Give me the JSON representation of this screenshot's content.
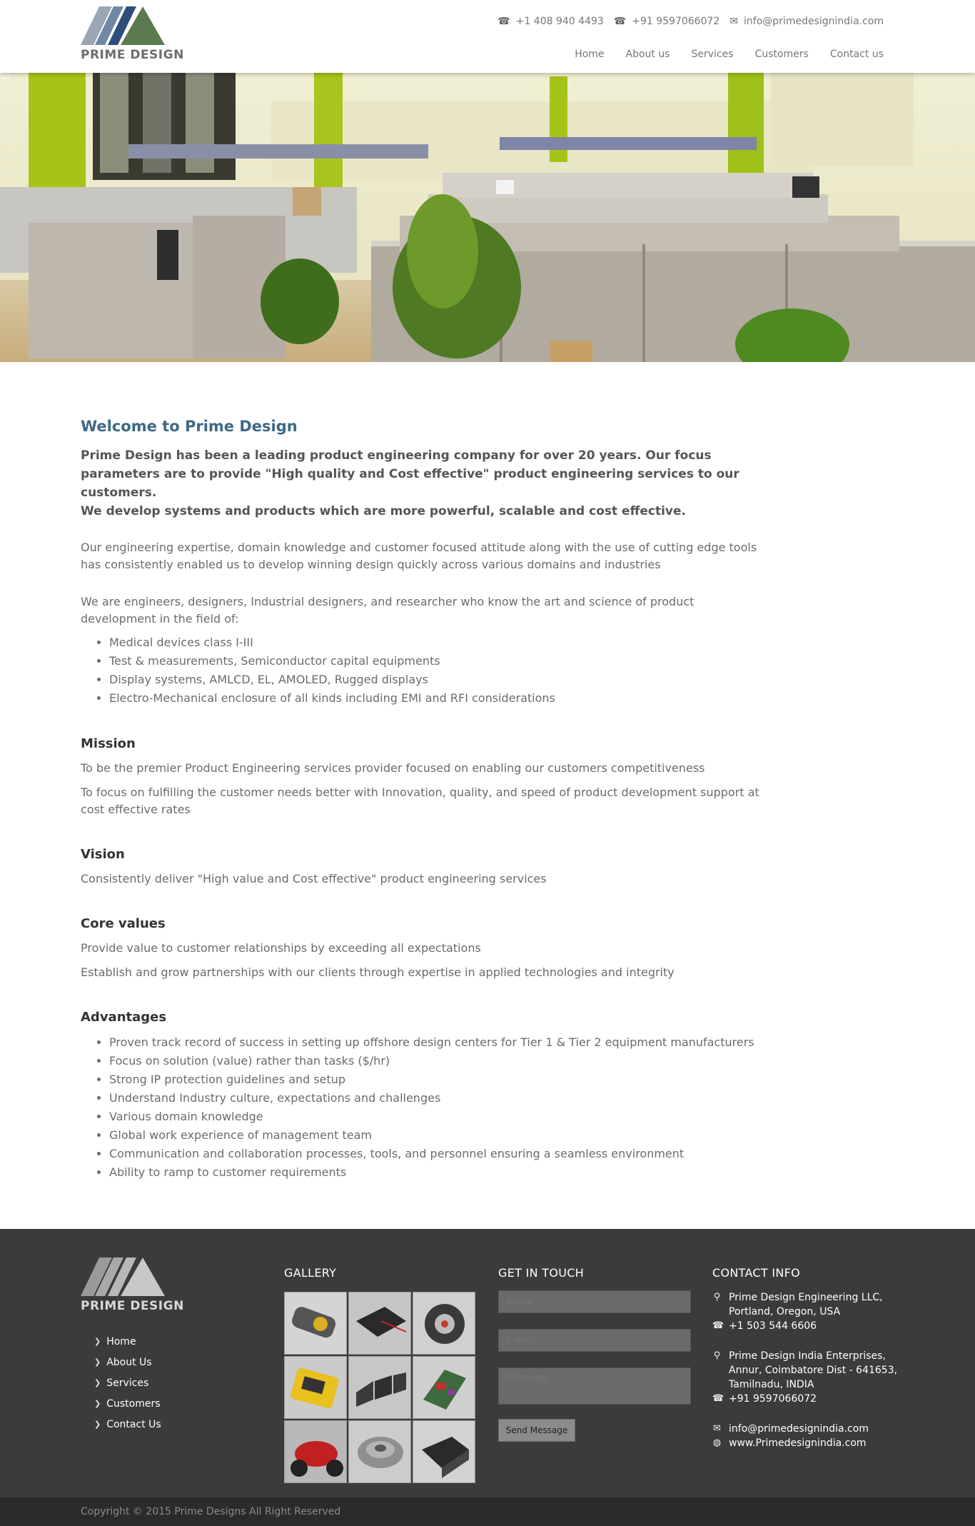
{
  "brand": {
    "name": "PRIME DESIGN"
  },
  "header": {
    "phone_us": "+1 408 940 4493",
    "phone_in": "+91 9597066072",
    "email": "info@primedesignindia.com",
    "nav": [
      "Home",
      "About us",
      "Services",
      "Customers",
      "Contact us"
    ]
  },
  "hero": {
    "overlay_text": "BA"
  },
  "main": {
    "welcome_title": "Welcome to Prime Design",
    "lead": [
      "Prime Design has been a leading product engineering company for over 20 years. Our focus parameters are to provide \"High quality and Cost effective\" product engineering services to our customers.",
      "We develop systems and products which are more powerful, scalable and cost effective."
    ],
    "expertise": "Our engineering expertise, domain knowledge and customer focused attitude along with the use of cutting edge tools has consistently enabled us to develop winning design quickly across various domains and industries",
    "intro_fields": "We are engineers, designers, Industrial designers, and researcher who know the art and science of product development in the field of:",
    "fields": [
      "Medical devices class I-III",
      "Test & measurements, Semiconductor capital equipments",
      "Display systems, AMLCD, EL, AMOLED, Rugged displays",
      "Electro-Mechanical enclosure of all kinds including EMI and RFI considerations"
    ],
    "mission": {
      "title": "Mission",
      "lines": [
        "To be the premier Product Engineering services provider focused on enabling our customers competitiveness",
        "To focus on fulfilling the customer needs better with Innovation, quality, and speed of product development support at cost effective rates"
      ]
    },
    "vision": {
      "title": "Vision",
      "lines": [
        "Consistently deliver \"High value and Cost effective\" product engineering services"
      ]
    },
    "core_values": {
      "title": "Core values",
      "lines": [
        "Provide value to customer relationships by exceeding all expectations",
        "Establish and grow partnerships with our clients through expertise in applied technologies and integrity"
      ]
    },
    "advantages": {
      "title": "Advantages",
      "items": [
        "Proven track record of success in setting up offshore design centers for Tier 1 & Tier 2 equipment manufacturers",
        "Focus on solution (value) rather than tasks ($/hr)",
        "Strong IP protection guidelines and setup",
        "Understand Industry culture, expectations and challenges",
        "Various domain knowledge",
        "Global work experience of management team",
        "Communication and collaboration processes, tools, and personnel ensuring a seamless environment",
        "Ability to ramp to customer requirements"
      ]
    }
  },
  "footer": {
    "links": [
      "Home",
      "About Us",
      "Services",
      "Customers",
      "Contact Us"
    ],
    "gallery_title": "GALLERY",
    "touch_title": "GET IN TOUCH",
    "form": {
      "name_placeholder": "Name",
      "email_placeholder": "E-mail",
      "message_placeholder": "Message",
      "send_label": "Send Message"
    },
    "contact_title": "CONTACT INFO",
    "us_address": [
      "Prime Design Engineering LLC,",
      "Portland, Oregon, USA"
    ],
    "us_phone": "+1 503 544 6606",
    "in_address": [
      "Prime Design India Enterprises,",
      "Annur, Coimbatore Dist - 641653,",
      "Tamilnadu, INDIA"
    ],
    "in_phone": "+91 9597066072",
    "email": "info@primedesignindia.com",
    "website": "www.Primedesignindia.com",
    "copyright": "Copyright © 2015 Prime Designs All Right Reserved"
  },
  "colors": {
    "heading_blue": "#3d6a87",
    "footer_bg": "#3b3b3b",
    "logo_green": "#5a7a4f",
    "logo_blue": "#2e4d7a"
  }
}
